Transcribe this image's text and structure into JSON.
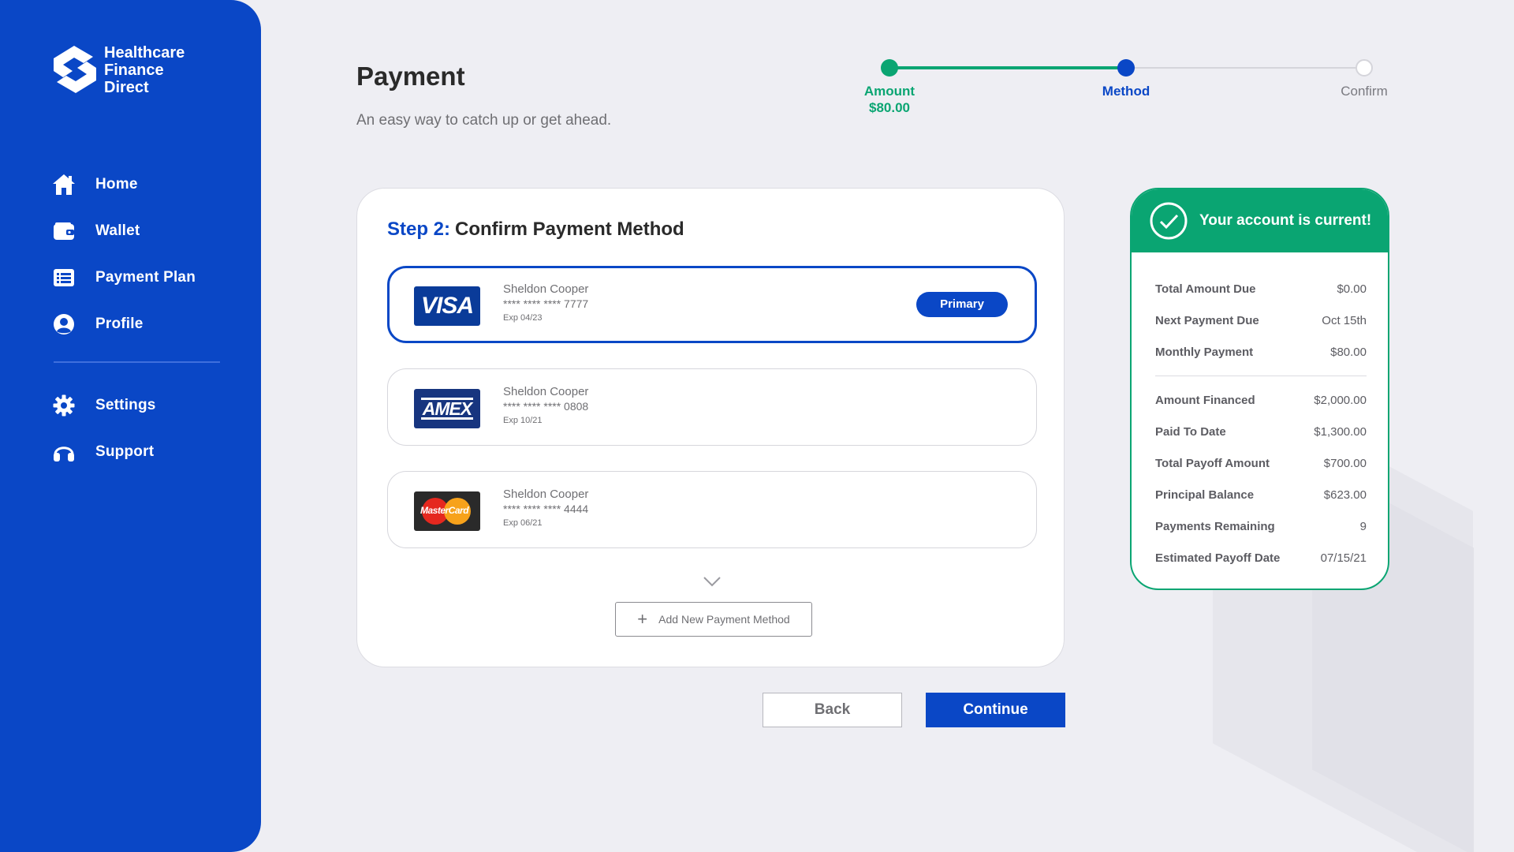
{
  "brand": {
    "name_line1": "Healthcare",
    "name_line2": "Finance",
    "name_line3": "Direct",
    "icon": "hfd-logo-icon"
  },
  "nav": [
    {
      "label": "Home",
      "icon": "home-icon"
    },
    {
      "label": "Wallet",
      "icon": "wallet-icon"
    },
    {
      "label": "Payment Plan",
      "icon": "list-icon"
    },
    {
      "label": "Profile",
      "icon": "user-icon"
    }
  ],
  "nav_secondary": [
    {
      "label": "Settings",
      "icon": "gear-icon"
    },
    {
      "label": "Support",
      "icon": "headset-icon"
    }
  ],
  "header": {
    "title": "Payment",
    "subtitle": "An easy way to catch up or get ahead."
  },
  "stepper": {
    "steps": [
      {
        "label": "Amount",
        "value": "$80.00",
        "state": "done"
      },
      {
        "label": "Method",
        "state": "current"
      },
      {
        "label": "Confirm",
        "state": "pending"
      }
    ]
  },
  "card": {
    "step_prefix": "Step 2:",
    "title": "Confirm Payment Method",
    "methods": [
      {
        "brand": "VISA",
        "holder": "Sheldon Cooper",
        "number": "****  ****  ****  7777",
        "exp": "Exp 04/23",
        "badge": "Primary",
        "selected": true
      },
      {
        "brand": "AMEX",
        "holder": "Sheldon Cooper",
        "number": "****  ****  ****  0808",
        "exp": "Exp 10/21",
        "selected": false
      },
      {
        "brand": "MasterCard",
        "holder": "Sheldon Cooper",
        "number": "****  ****  ****  4444",
        "exp": "Exp 06/21",
        "selected": false
      }
    ],
    "add_label": "Add New Payment Method"
  },
  "actions": {
    "back": "Back",
    "continue": "Continue"
  },
  "summary": {
    "status": "Your account is current!",
    "group1": [
      {
        "k": "Total Amount Due",
        "v": "$0.00"
      },
      {
        "k": "Next Payment Due",
        "v": "Oct 15th"
      },
      {
        "k": "Monthly Payment",
        "v": "$80.00"
      }
    ],
    "group2": [
      {
        "k": "Amount Financed",
        "v": "$2,000.00"
      },
      {
        "k": "Paid To Date",
        "v": "$1,300.00"
      },
      {
        "k": "Total Payoff Amount",
        "v": "$700.00"
      },
      {
        "k": "Principal Balance",
        "v": "$623.00"
      },
      {
        "k": "Payments Remaining",
        "v": "9"
      },
      {
        "k": "Estimated Payoff Date",
        "v": "07/15/21"
      }
    ]
  },
  "colors": {
    "primary": "#0a47c6",
    "success": "#0aa572",
    "background": "#eeeef3"
  }
}
